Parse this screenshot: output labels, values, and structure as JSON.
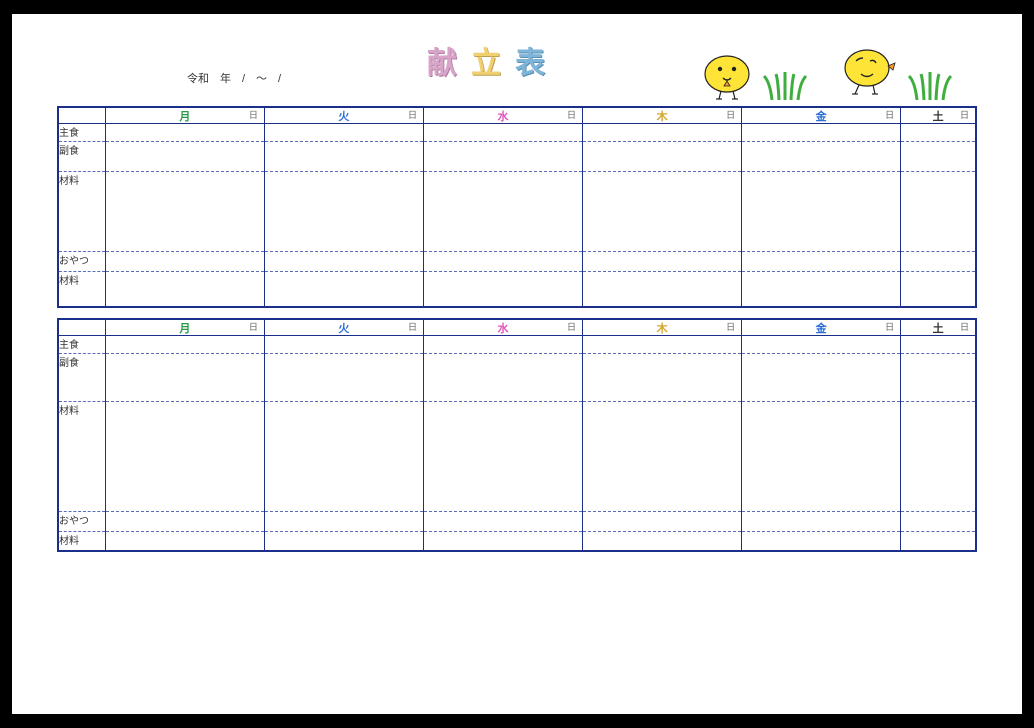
{
  "dateLine": "令和　年　/　～　/",
  "title": {
    "c1": "献",
    "c2": "立",
    "c3": "表"
  },
  "days": [
    {
      "label": "月",
      "color": "#2a9a45",
      "suffix": "日"
    },
    {
      "label": "火",
      "color": "#2a6dd4",
      "suffix": "日"
    },
    {
      "label": "水",
      "color": "#e055b8",
      "suffix": "日"
    },
    {
      "label": "木",
      "color": "#d4a52a",
      "suffix": "日"
    },
    {
      "label": "金",
      "color": "#2a6dd4",
      "suffix": "日"
    },
    {
      "label": "土",
      "color": "#333333",
      "suffix": "日"
    }
  ],
  "week1": {
    "rows": [
      {
        "label": "主食",
        "h": "h1"
      },
      {
        "label": "副食",
        "h": "h2"
      },
      {
        "label": "材料",
        "h": "h3"
      },
      {
        "label": "おやつ",
        "h": "h4"
      },
      {
        "label": "材料",
        "h": "h5"
      }
    ]
  },
  "week2": {
    "rows": [
      {
        "label": "主食",
        "h": "h1"
      },
      {
        "label": "副食",
        "h": "h2"
      },
      {
        "label": "材料",
        "h": "h3"
      },
      {
        "label": "おやつ",
        "h": "h4"
      },
      {
        "label": "材料",
        "h": "h5"
      }
    ]
  }
}
